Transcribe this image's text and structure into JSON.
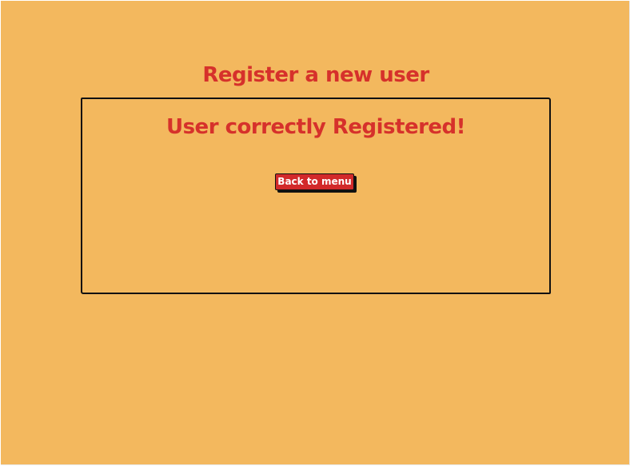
{
  "header": {
    "title": "Register a new user"
  },
  "panel": {
    "message": "User correctly Registered!",
    "back_button_label": "Back to menu"
  },
  "colors": {
    "background": "#f3b85e",
    "accent_text": "#d6312b",
    "button": "#d2292a",
    "border": "#111111"
  }
}
